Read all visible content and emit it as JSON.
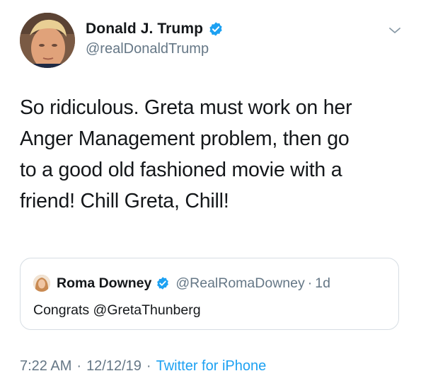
{
  "author": {
    "display_name": "Donald J. Trump",
    "handle": "@realDonaldTrump",
    "verified": true,
    "avatar_icon": "profile-photo"
  },
  "menu_icon": "chevron-down-icon",
  "tweet": {
    "text_lines": [
      "So ridiculous. Greta must work on her",
      "Anger Management problem, then go",
      "to a good old fashioned movie with a",
      "friend! Chill Greta, Chill!"
    ]
  },
  "quoted_tweet": {
    "display_name": "Roma Downey",
    "handle": "@RealRomaDowney",
    "separator": "·",
    "time": "1d",
    "verified": true,
    "text": "Congrats @GretaThunberg"
  },
  "meta": {
    "time": "7:22 AM",
    "separator": "·",
    "date": "12/12/19",
    "source": "Twitter for iPhone"
  },
  "colors": {
    "text": "#14171a",
    "secondary": "#657786",
    "link": "#1da1f2",
    "verified": "#1da1f2",
    "border": "#d6dde3"
  }
}
